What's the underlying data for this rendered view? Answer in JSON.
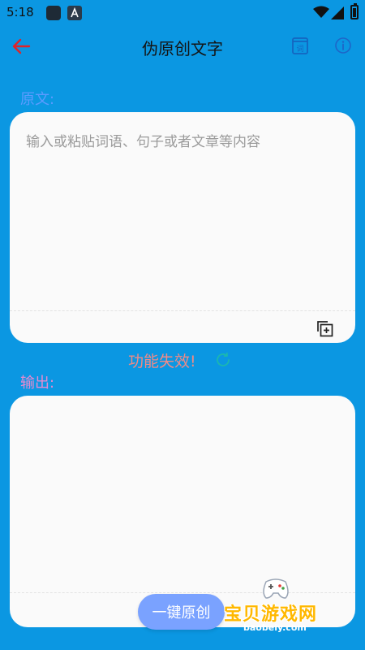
{
  "status_bar": {
    "time": "5:18"
  },
  "app_bar": {
    "title": "伪原创文字",
    "dict_icon_label": "词"
  },
  "original_section": {
    "label": "原文:",
    "placeholder": "输入或粘贴词语、句子或者文章等内容",
    "value": ""
  },
  "status": {
    "message": "功能失效!"
  },
  "output_section": {
    "label": "输出:",
    "value": ""
  },
  "actions": {
    "one_click_label": "一键原创"
  },
  "watermark": {
    "text": "宝贝游戏网",
    "url": "baobeiy.com"
  },
  "colors": {
    "background": "#0b97e2",
    "card": "#fafafa",
    "original_label": "#5c9bff",
    "output_label": "#e88ad0",
    "status_message": "#f08a86",
    "back_arrow": "#e0242a",
    "button": "#7aa2ff"
  },
  "icons": {
    "back": "arrow-left-icon",
    "dictionary": "dictionary-icon",
    "info": "info-icon",
    "copy": "copy-add-icon",
    "refresh": "refresh-icon"
  }
}
